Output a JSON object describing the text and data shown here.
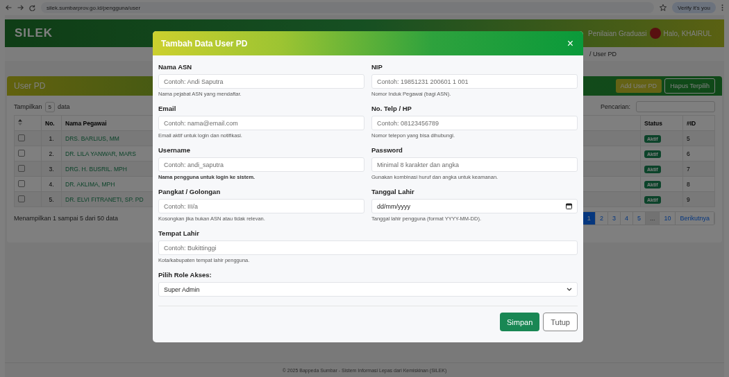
{
  "browser": {
    "url": "silek.sumbarprov.go.id/pengguna/user",
    "profile_button": "Verify it's you"
  },
  "navbar": {
    "brand": "SILEK",
    "items": [
      "Penilaian Graduasi"
    ],
    "user": "Halo, KHAIRUL"
  },
  "breadcrumb": "/ User PD",
  "card": {
    "title": "User PD",
    "buttons": [
      "Add User PD",
      "Hapus Terpilih"
    ],
    "show_label": "Tampilkan",
    "page_size": "5",
    "show_suffix": "data",
    "search_label": "Pencarian:",
    "columns": [
      "No.",
      "Nama Pegawai",
      "Status",
      "#ID"
    ],
    "rows": [
      {
        "checked": false,
        "no": "1.",
        "name": "DRS. BARLIUS, MM",
        "status": "Aktif",
        "id": "5"
      },
      {
        "checked": false,
        "no": "2.",
        "name": "DR. LILA YANWAR, MARS",
        "status": "Aktif",
        "id": "6"
      },
      {
        "checked": false,
        "no": "3.",
        "name": "DRG. H. BUSRIL. MPH",
        "status": "Aktif",
        "id": "7"
      },
      {
        "checked": false,
        "no": "4.",
        "name": "DR. AKLIMA, MPH",
        "status": "Aktif",
        "id": "8"
      },
      {
        "checked": false,
        "no": "5.",
        "name": "DR. ELVI FITRANETI, SP. PD",
        "status": "Aktif",
        "id": "9"
      }
    ],
    "info": "Menampilkan 1 sampai 5 dari 50 data",
    "pagination": [
      {
        "label": "1",
        "selected": true,
        "disabled": false
      },
      {
        "label": "2",
        "selected": false,
        "disabled": false
      },
      {
        "label": "3",
        "selected": false,
        "disabled": false
      },
      {
        "label": "4",
        "selected": false,
        "disabled": false
      },
      {
        "label": "5",
        "selected": false,
        "disabled": false
      },
      {
        "label": "...",
        "selected": false,
        "disabled": true
      },
      {
        "label": "10",
        "selected": false,
        "disabled": false
      },
      {
        "label": "Berikutnya",
        "selected": false,
        "disabled": false
      }
    ]
  },
  "modal": {
    "title": "Tambah Data User PD",
    "close": "×",
    "fields": [
      {
        "kind": "text",
        "label": "Nama ASN",
        "placeholder": "Contoh: Andi Saputra",
        "help": "Nama pejabat ASN yang mendaftar.",
        "bold_help": false
      },
      {
        "kind": "text",
        "label": "NIP",
        "placeholder": "Contoh: 19851231 200601 1 001",
        "help": "Nomor Induk Pegawai (bagi ASN).",
        "bold_help": false
      },
      {
        "kind": "text",
        "label": "Email",
        "placeholder": "Contoh: nama@email.com",
        "help": "Email aktif untuk login dan notifikasi.",
        "bold_help": false
      },
      {
        "kind": "text",
        "label": "No. Telp / HP",
        "placeholder": "Contoh: 08123456789",
        "help": "Nomor telepon yang bisa dihubungi.",
        "bold_help": false
      },
      {
        "kind": "text",
        "label": "Username",
        "placeholder": "Contoh: andi_saputra",
        "help": "Nama pengguna untuk login ke sistem.",
        "bold_help": true
      },
      {
        "kind": "text",
        "label": "Password",
        "placeholder": "Minimal 8 karakter dan angka",
        "help": "Gunakan kombinasi huruf dan angka untuk keamanan.",
        "bold_help": false
      },
      {
        "kind": "text",
        "label": "Pangkat / Golongan",
        "placeholder": "Contoh: III/a",
        "help": "Kosongkan jika bukan ASN atau tidak relevan.",
        "bold_help": false
      },
      {
        "kind": "date",
        "label": "Tanggal Lahir",
        "value": "dd/mm/yyyy",
        "help": "Tanggal lahir pengguna (format YYYY-MM-DD).",
        "bold_help": false
      }
    ],
    "wide_field": {
      "label": "Tempat Lahir",
      "placeholder": "Contoh: Bukittinggi",
      "help": "Kota/kabupaten tempat lahir pengguna."
    },
    "role_select": {
      "label": "Pilih Role Akses:",
      "value": "Super Admin"
    },
    "buttons": [
      "Simpan",
      "Tutup"
    ]
  },
  "footer": "© 2025 Bappeda Sumbar - Sistem Informasi Lepas dari Kemiskinan (SILEK)"
}
